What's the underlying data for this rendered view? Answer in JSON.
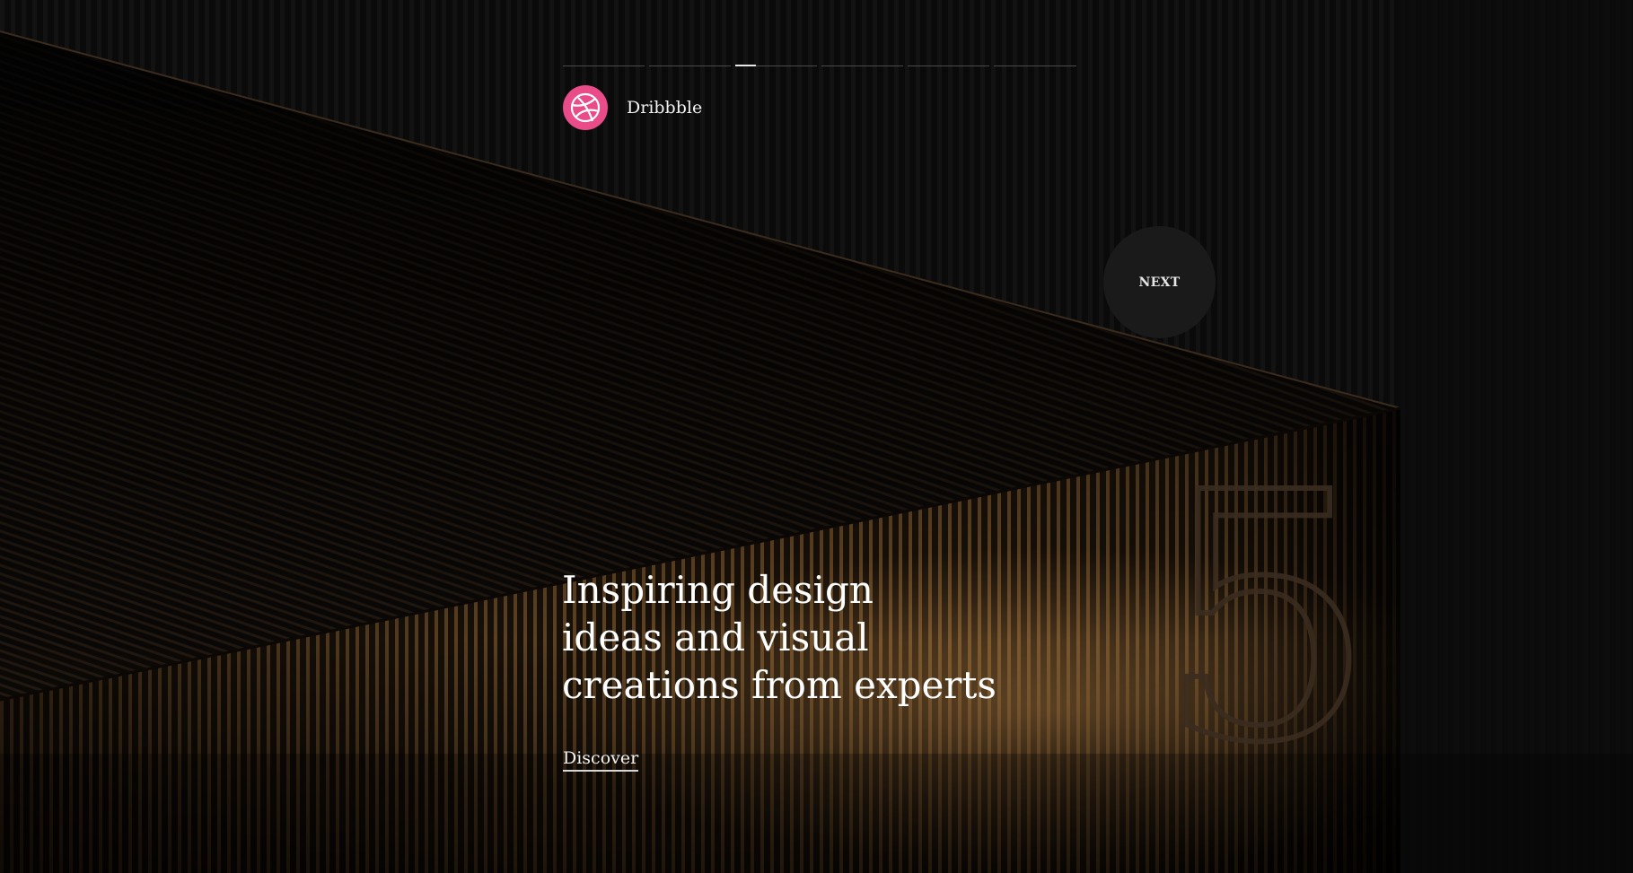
{
  "brand": {
    "logo_icon": "dribbble-ball-icon",
    "logo_color": "#ea4c89",
    "name": "Dribbble"
  },
  "slider": {
    "slide_count": 6,
    "active_slide": 3,
    "active_progress": 0.25
  },
  "next_button": {
    "label": "NEXT"
  },
  "hero": {
    "headline_lines": [
      "Inspiring design",
      "ideas and visual",
      "creations from experts"
    ],
    "cta_label": "Discover"
  },
  "background": {
    "decorative_numeral": "5",
    "accent_color": "#c08a4a"
  }
}
